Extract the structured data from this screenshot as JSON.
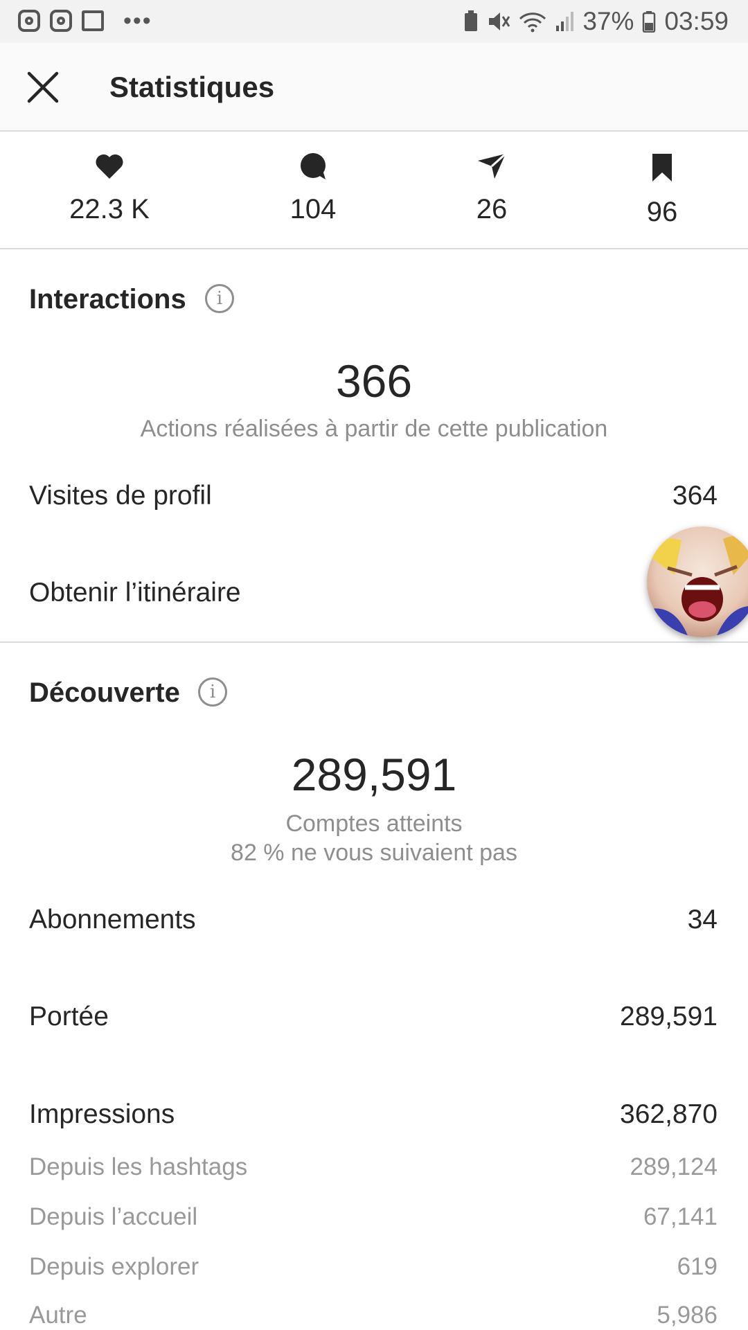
{
  "status_bar": {
    "left_icons": [
      "instagram-icon",
      "instagram-icon",
      "image-icon",
      "more-dots-icon"
    ],
    "battery_percent": "37%",
    "time": "03:59"
  },
  "header": {
    "title": "Statistiques"
  },
  "top_stats": [
    {
      "icon": "heart-icon",
      "value": "22.3 K"
    },
    {
      "icon": "comment-icon",
      "value": "104"
    },
    {
      "icon": "share-icon",
      "value": "26"
    },
    {
      "icon": "bookmark-icon",
      "value": "96"
    }
  ],
  "interactions": {
    "title": "Interactions",
    "total": "366",
    "caption": "Actions réalisées à partir de cette publication",
    "rows": [
      {
        "label": "Visites de profil",
        "value": "364"
      },
      {
        "label": "Obtenir l’itinéraire",
        "value": ""
      }
    ]
  },
  "discovery": {
    "title": "Découverte",
    "total": "289,591",
    "caption": "Comptes atteints",
    "caption2": "82 % ne vous suivaient pas",
    "rows": [
      {
        "label": "Abonnements",
        "value": "34"
      },
      {
        "label": "Portée",
        "value": "289,591"
      },
      {
        "label": "Impressions",
        "value": "362,870"
      }
    ],
    "sub_rows": [
      {
        "label": "Depuis les hashtags",
        "value": "289,124"
      },
      {
        "label": "Depuis l’accueil",
        "value": "67,141"
      },
      {
        "label": "Depuis explorer",
        "value": "619"
      },
      {
        "label": "Autre",
        "value": "5,986"
      }
    ]
  },
  "colors": {
    "text": "#262626",
    "muted": "#8e8e8e",
    "divider": "#dbdbdb"
  }
}
